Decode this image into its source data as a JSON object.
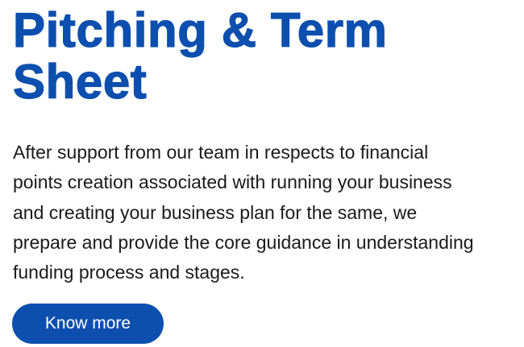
{
  "heading": {
    "line1": "Pitching & Term",
    "line2": "Sheet"
  },
  "description": {
    "line1": "After support from our team in respects to financial",
    "line2": "points creation associated with running your business",
    "line3": "and creating your business plan for the same, we",
    "line4": "prepare and provide the core guidance in understanding",
    "line5": "funding process and stages."
  },
  "cta": {
    "label": "Know more"
  },
  "colors": {
    "accent": "#0d4fae",
    "text": "#1a1a1a",
    "background": "#ffffff"
  }
}
